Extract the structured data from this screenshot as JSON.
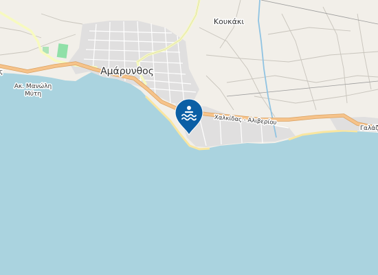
{
  "map": {
    "labels": {
      "town": "Αμάρυνθος",
      "village": "Κουκάκι",
      "cape_line1": "Ακ. Μανώλη",
      "cape_line2": "Μύτη",
      "road": "Χαλκίδας - Αλιβερίου",
      "edge_place": "Γαλάζ",
      "left_fragment": "ς"
    },
    "marker": {
      "type": "beach",
      "icon": "swimmer-icon",
      "color": "#0b5fa5"
    },
    "colors": {
      "sea": "#aad3df",
      "land": "#f2efe9",
      "urban": "#e0dfdf",
      "main_road": "#f6c38a",
      "secondary_road": "#f7fabf",
      "river": "#8fc3e2",
      "park": "#90e0a8",
      "beach": "#f9e6a0"
    }
  }
}
